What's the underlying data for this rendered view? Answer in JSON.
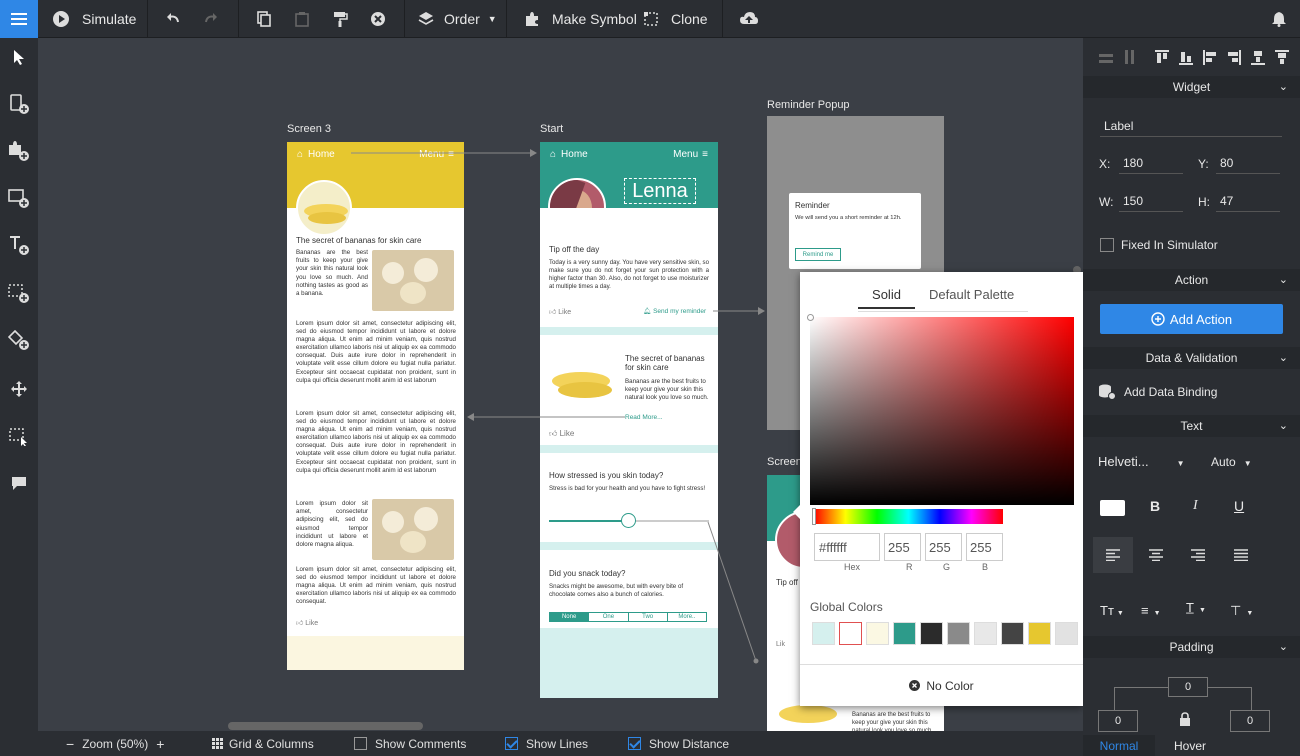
{
  "toolbar": {
    "simulate": "Simulate",
    "order": "Order",
    "make_symbol": "Make Symbol",
    "clone": "Clone"
  },
  "bottom": {
    "zoom": "Zoom (50%)",
    "grid": "Grid & Columns",
    "show_comments": "Show Comments",
    "show_lines": "Show Lines",
    "show_distance": "Show Distance"
  },
  "screens": {
    "screen3": {
      "name": "Screen 3",
      "home": "Home",
      "menu": "Menu",
      "title": "The secret of bananas for skin care",
      "intro": "Bananas are the best fruits to keep your give your skin this natural look you love so much. And nothing tastes as good as a banana.",
      "lorem1": "Lorem ipsum dolor sit amet, consectetur adipiscing elit, sed do eiusmod tempor incididunt ut labore et dolore magna aliqua. Ut enim ad minim veniam, quis nostrud exercitation ullamco laboris nisi ut aliquip ex ea commodo consequat. Duis aute irure dolor in reprehenderit in voluptate velit esse cillum dolore eu fugiat nulla pariatur. Excepteur sint occaecat cupidatat non proident, sunt in culpa qui officia deserunt mollit anim id est laborum",
      "lorem2": "Lorem ipsum dolor sit amet, consectetur adipiscing elit, sed do eiusmod tempor incididunt ut labore et dolore magna aliqua. Ut enim ad minim veniam, quis nostrud exercitation ullamco laboris nisi ut aliquip ex ea commodo consequat. Duis aute irure dolor in reprehenderit in voluptate velit esse cillum dolore eu fugiat nulla pariatur. Excepteur sint occaecat cupidatat non proident, sunt in culpa qui officia deserunt mollit anim id est laborum",
      "lorem3": "Lorem ipsum dolor sit amet, consectetur adipiscing elit, sed do eiusmod tempor incididunt ut labore et dolore magna aliqua.",
      "lorem4": "Lorem ipsum dolor sit amet, consectetur adipiscing elit, sed do eiusmod tempor incididunt ut labore et dolore magna aliqua. Ut enim ad minim veniam, quis nostrud exercitation ullamco laboris nisi ut aliquip ex ea commodo consequat.",
      "like": "Like"
    },
    "start": {
      "name": "Start",
      "home": "Home",
      "menu": "Menu",
      "user": "Lenna",
      "tip_title": "Tip off the day",
      "tip_body": "Today is a very sunny day. You have very sensitive skin, so make sure you do not forget your sun protection with a higher factor than 30. Also, do not forget to use moisturizer at multiple times a day.",
      "like": "Like",
      "send_reminder": "Send my reminder",
      "banana_title": "The secret of bananas for skin care",
      "banana_body": "Bananas are the best fruits to keep your give your skin this natural look you love so much.",
      "read_more": "Read More...",
      "like2": "Like",
      "stress_q": "How stressed is you skin today?",
      "stress_body": "Stress is bad for your health and you have to fight stress!",
      "snack_q": "Did you snack today?",
      "snack_body": "Snacks might be awesome, but with every bite of chocolate comes also a bunch of calories.",
      "snack_options": [
        "None",
        "One",
        "Two",
        "More.."
      ]
    },
    "reminder": {
      "name": "Reminder Popup",
      "title": "Reminder",
      "body": "We will send you a short reminder at 12h.",
      "button": "Remind me"
    },
    "screen_partial": {
      "name": "Screen",
      "tip": "Tip off",
      "like": "Lik",
      "banana_body": "Bananas are the best fruits to keep your give your skin this natural look you love so much."
    }
  },
  "colorpicker": {
    "tab_solid": "Solid",
    "tab_palette": "Default Palette",
    "hex": "#ffffff",
    "r": "255",
    "g": "255",
    "b": "255",
    "hex_label": "Hex",
    "r_label": "R",
    "g_label": "G",
    "b_label": "B",
    "global_colors_label": "Global Colors",
    "global_colors": [
      "#d5f0ee",
      "#ffffff",
      "#fbf8e3",
      "#2d9b8a",
      "#2b2b2b",
      "#8a8a8a",
      "#e8e8e8",
      "#444444",
      "#e6c72f",
      "#e2e2e2"
    ],
    "no_color": "No Color"
  },
  "panel": {
    "widget_section": "Widget",
    "label_value": "Label",
    "x_label": "X:",
    "x": "180",
    "y_label": "Y:",
    "y": "80",
    "w_label": "W:",
    "w": "150",
    "h_label": "H:",
    "h": "47",
    "fixed": "Fixed In Simulator",
    "action_section": "Action",
    "add_action": "Add Action",
    "data_section": "Data & Validation",
    "add_binding": "Add Data Binding",
    "text_section": "Text",
    "font": "Helveti...",
    "size": "Auto",
    "bold": "B",
    "italic": "I",
    "underline": "U",
    "padding_section": "Padding",
    "pad_top": "0",
    "pad_left": "0",
    "pad_right": "0",
    "tab_normal": "Normal",
    "tab_hover": "Hover"
  },
  "colors": {
    "accent": "#2f87e6",
    "teal": "#2d9b8a",
    "yellow": "#e6c72f"
  }
}
